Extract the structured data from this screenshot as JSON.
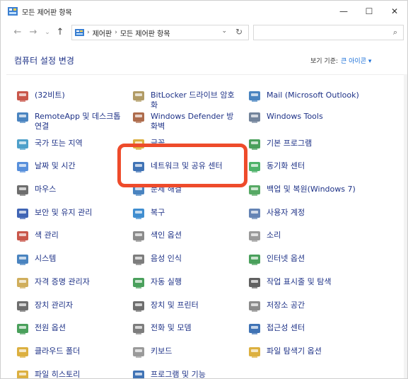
{
  "window": {
    "title": "모든 제어판 항목",
    "controls": [
      "—",
      "☐",
      "✕"
    ]
  },
  "address": {
    "crumbs": [
      "제어판",
      "모든 제어판 항목"
    ],
    "search_placeholder": ""
  },
  "header": {
    "heading": "컴퓨터 설정 변경",
    "view_by_label": "보기 기준:",
    "view_by_value": "큰 아이콘 ▾"
  },
  "items": [
    {
      "label": "(32비트)",
      "icon": "java-icon",
      "color": "#c0392b"
    },
    {
      "label": "BitLocker 드라이브 암호화",
      "icon": "key-icon",
      "color": "#a38a4a"
    },
    {
      "label": "Mail (Microsoft Outlook)",
      "icon": "mail-icon",
      "color": "#2a6fb5"
    },
    {
      "label": "RemoteApp 및 데스크톱 연결",
      "icon": "remoteapp-icon",
      "color": "#2a6fb5"
    },
    {
      "label": "Windows Defender 방화벽",
      "icon": "firewall-icon",
      "color": "#a0522d"
    },
    {
      "label": "Windows Tools",
      "icon": "tools-icon",
      "color": "#5a6e8a"
    },
    {
      "label": "국가 또는 지역",
      "icon": "region-icon",
      "color": "#2f8fc1"
    },
    {
      "label": "글꼴",
      "icon": "fonts-icon",
      "color": "#d6a21e"
    },
    {
      "label": "기본 프로그램",
      "icon": "default-programs-icon",
      "color": "#2a8f3f"
    },
    {
      "label": "날짜 및 시간",
      "icon": "calendar-clock-icon",
      "color": "#3a7bd5"
    },
    {
      "label": "네트워크 및 공유 센터",
      "icon": "network-icon",
      "color": "#1e5aa8"
    },
    {
      "label": "동기화 센터",
      "icon": "sync-icon",
      "color": "#2ea44f"
    },
    {
      "label": "마우스",
      "icon": "mouse-icon",
      "color": "#555555"
    },
    {
      "label": "문제 해결",
      "icon": "troubleshoot-icon",
      "color": "#2a6fb5"
    },
    {
      "label": "백업 및 복원(Windows 7)",
      "icon": "backup-icon",
      "color": "#3a9a4a"
    },
    {
      "label": "보안 및 유지 관리",
      "icon": "flag-icon",
      "color": "#1e4aa8"
    },
    {
      "label": "복구",
      "icon": "recovery-icon",
      "color": "#1e7ac8"
    },
    {
      "label": "사용자 계정",
      "icon": "users-icon",
      "color": "#4a6fa8"
    },
    {
      "label": "색 관리",
      "icon": "color-management-icon",
      "color": "#c0392b"
    },
    {
      "label": "색인 옵션",
      "icon": "indexing-icon",
      "color": "#777777"
    },
    {
      "label": "소리",
      "icon": "speaker-icon",
      "color": "#888888"
    },
    {
      "label": "시스템",
      "icon": "monitor-icon",
      "color": "#2a6fb5"
    },
    {
      "label": "음성 인식",
      "icon": "microphone-icon",
      "color": "#666666"
    },
    {
      "label": "인터넷 옵션",
      "icon": "globe-icon",
      "color": "#2a8f3f"
    },
    {
      "label": "자격 증명 관리자",
      "icon": "credential-icon",
      "color": "#c8a040"
    },
    {
      "label": "자동 실행",
      "icon": "autoplay-icon",
      "color": "#2a8f3f"
    },
    {
      "label": "작업 표시줄 및 탐색",
      "icon": "taskbar-icon",
      "color": "#444444"
    },
    {
      "label": "장치 관리자",
      "icon": "device-manager-icon",
      "color": "#555555"
    },
    {
      "label": "장치 및 프린터",
      "icon": "printer-icon",
      "color": "#555555"
    },
    {
      "label": "저장소 공간",
      "icon": "storage-icon",
      "color": "#777777"
    },
    {
      "label": "전원 옵션",
      "icon": "power-icon",
      "color": "#2a8f3f"
    },
    {
      "label": "전화 및 모뎀",
      "icon": "phone-icon",
      "color": "#666666"
    },
    {
      "label": "접근성 센터",
      "icon": "accessibility-icon",
      "color": "#1e5aa8"
    },
    {
      "label": "클라우드 폴더",
      "icon": "work-folders-icon",
      "color": "#d6a21e"
    },
    {
      "label": "키보드",
      "icon": "keyboard-icon",
      "color": "#888888"
    },
    {
      "label": "파일 탐색기 옵션",
      "icon": "folder-options-icon",
      "color": "#d6a21e"
    },
    {
      "label": "파일 히스토리",
      "icon": "file-history-icon",
      "color": "#d6a21e"
    },
    {
      "label": "프로그램 및 기능",
      "icon": "programs-features-icon",
      "color": "#1e5aa8"
    }
  ],
  "highlight_color": "#ee4b2b"
}
